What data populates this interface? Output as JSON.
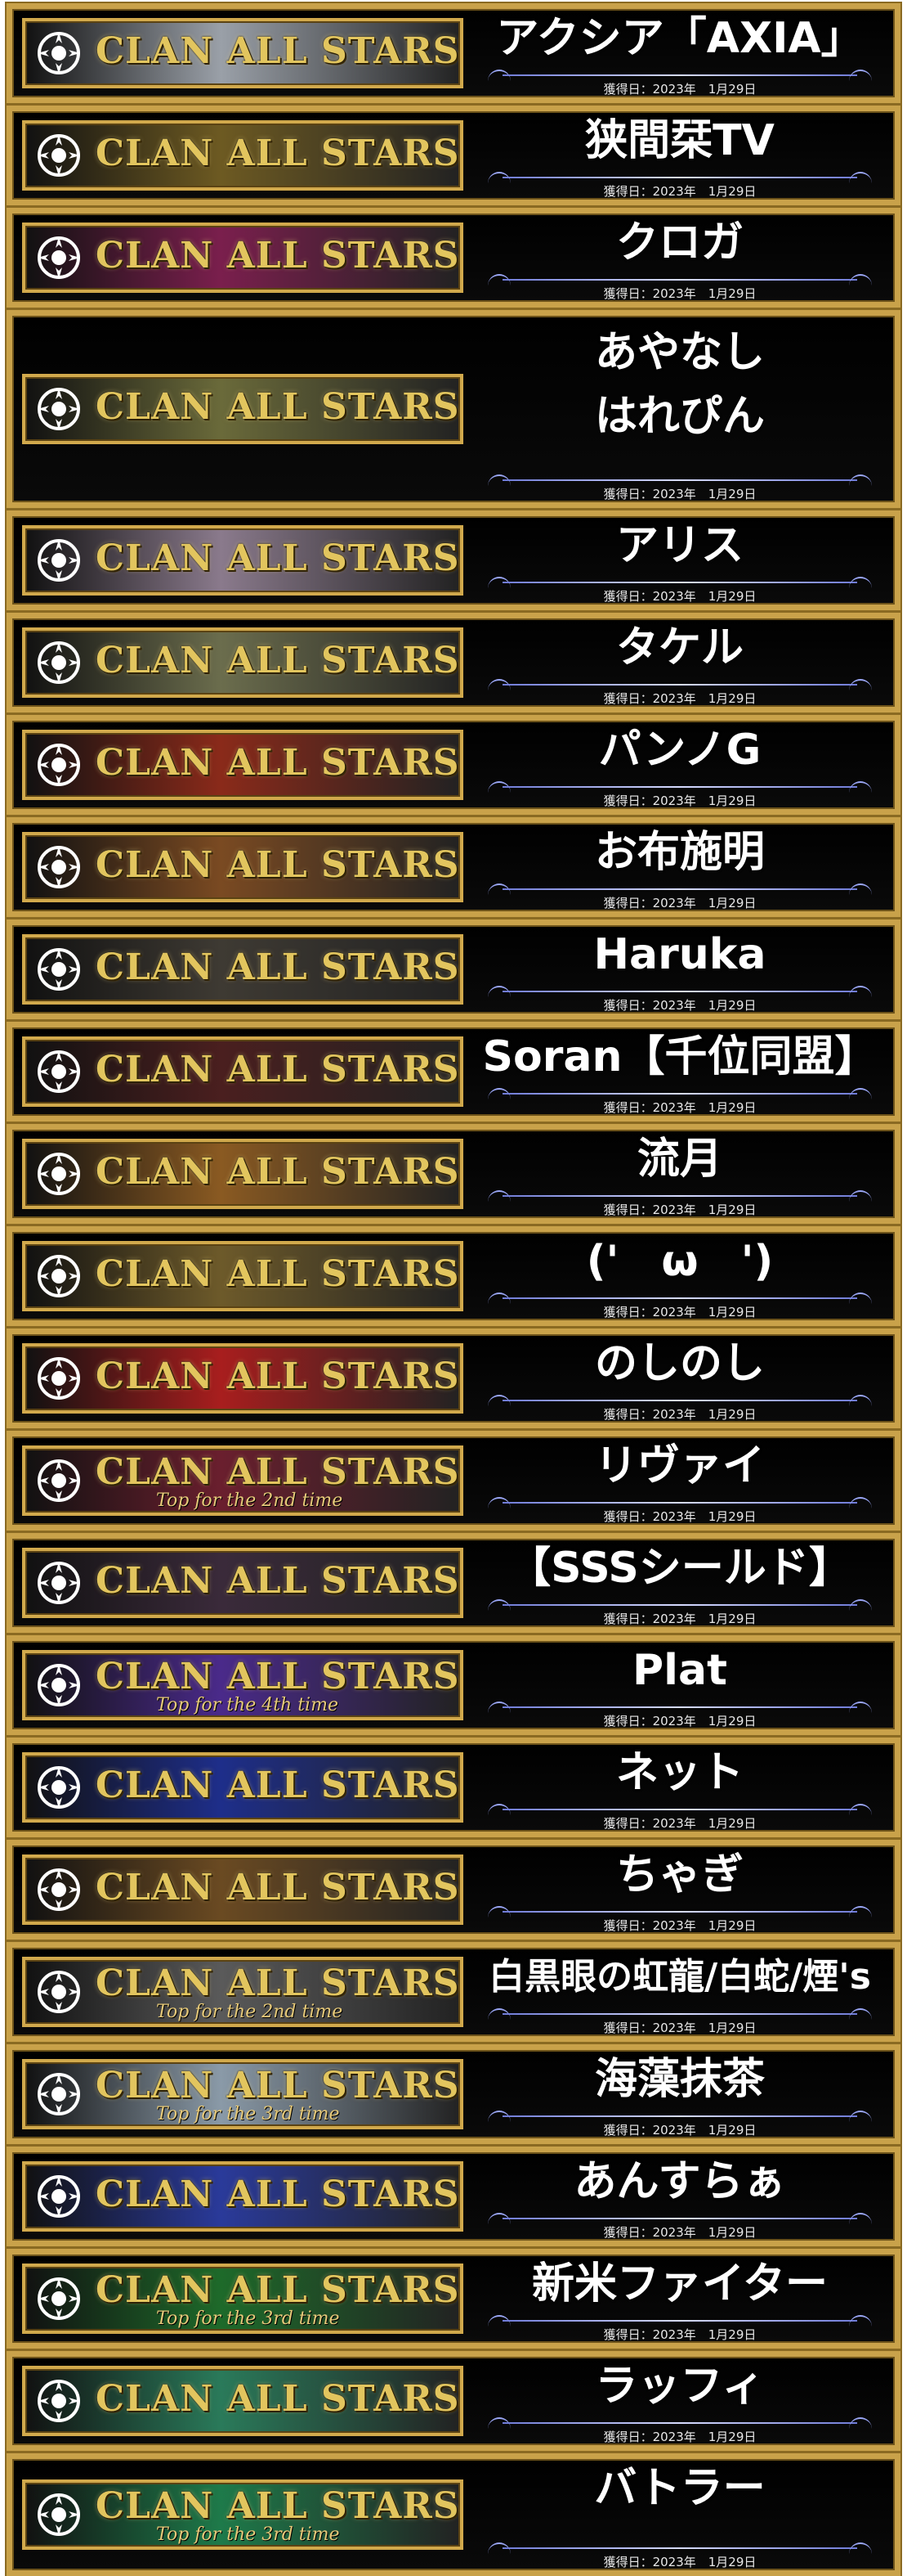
{
  "brand_text": "CLAN ALL STARS",
  "date_text": "獲得日：2023年　1月29日",
  "entries": [
    {
      "name": "アクシア「AXIA」",
      "sub": "",
      "color": "#9aa0a8",
      "icon": "sun-emblem-icon"
    },
    {
      "name": "狭間栞TV",
      "sub": "",
      "color": "#6d5a22",
      "icon": "ornament-emblem-icon"
    },
    {
      "name": "クロガ",
      "sub": "",
      "color": "#7a1f4d",
      "icon": "star-emblem-icon"
    },
    {
      "name": "あやなし\nはれぴん",
      "sub": "",
      "color": "#6a6a3a",
      "icon": "cross-emblem-icon"
    },
    {
      "name": "アリス",
      "sub": "",
      "color": "#8a7a8c",
      "icon": "crown-emblem-icon"
    },
    {
      "name": "タケル",
      "sub": "",
      "color": "#6b6d4d",
      "icon": "infinity-emblem-icon"
    },
    {
      "name": "パンノG",
      "sub": "",
      "color": "#8a2a1a",
      "icon": "flame-emblem-icon"
    },
    {
      "name": "お布施明",
      "sub": "",
      "color": "#7a4a22",
      "icon": "tower-emblem-icon"
    },
    {
      "name": "Haruka",
      "sub": "",
      "color": "#3e3a33",
      "icon": "helm-emblem-icon"
    },
    {
      "name": "Soran【千位同盟】",
      "sub": "",
      "color": "#4a1f1f",
      "icon": "swirl-emblem-icon"
    },
    {
      "name": "流月",
      "sub": "",
      "color": "#8a5a22",
      "icon": "wing-emblem-icon"
    },
    {
      "name": "('　ω　')",
      "sub": "",
      "color": "#6d5a2a",
      "icon": "horn-emblem-icon"
    },
    {
      "name": "のしのし",
      "sub": "",
      "color": "#a81e1e",
      "icon": "shield-emblem-icon"
    },
    {
      "name": "リヴァイ",
      "sub": "Top for the 2nd time",
      "color": "#6a1f2e",
      "icon": "atom-emblem-icon"
    },
    {
      "name": "【SSSシールド】",
      "sub": "",
      "color": "#3a2a3a",
      "icon": "spider-emblem-icon"
    },
    {
      "name": "Plat",
      "sub": "Top for the 4th time",
      "color": "#4a2a8a",
      "icon": "snow-emblem-icon"
    },
    {
      "name": "ネット",
      "sub": "",
      "color": "#1e2e8a",
      "icon": "gear-emblem-icon"
    },
    {
      "name": "ちゃぎ",
      "sub": "",
      "color": "#6a4a22",
      "icon": "puzzle-emblem-icon"
    },
    {
      "name": "白黒眼の虹龍/白蛇/煙's",
      "sub": "Top for the 2nd time",
      "color": "#5a5a5a",
      "icon": "skull-emblem-icon"
    },
    {
      "name": "海藻抹茶",
      "sub": "Top for the 3rd time",
      "color": "#8a9aa8",
      "icon": "diamond-emblem-icon"
    },
    {
      "name": "あんすらぁ",
      "sub": "",
      "color": "#2a3a9a",
      "icon": "flower-emblem-icon"
    },
    {
      "name": "新米ファイター",
      "sub": "Top for the 3rd time",
      "color": "#1e6a2a",
      "icon": "lattice-emblem-icon"
    },
    {
      "name": "ラッフィ",
      "sub": "",
      "color": "#2a7a5a",
      "icon": "gem-emblem-icon"
    },
    {
      "name": "バトラー",
      "sub": "Top for the 3rd time",
      "color": "#1e7a4a",
      "icon": "leaf-emblem-icon"
    }
  ]
}
